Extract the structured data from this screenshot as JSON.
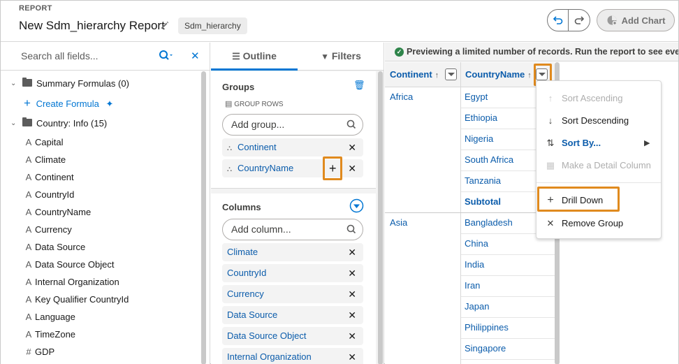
{
  "header": {
    "eyebrow": "REPORT",
    "title": "New Sdm_hierarchy Report",
    "report_type": "Sdm_hierarchy",
    "add_chart_label": "Add Chart"
  },
  "fields_panel": {
    "search_placeholder": "Search all fields...",
    "summary_formulas_label": "Summary Formulas (0)",
    "create_formula_label": "Create Formula",
    "country_info_label": "Country: Info (15)",
    "fields": [
      {
        "glyph": "A",
        "label": "Capital"
      },
      {
        "glyph": "A",
        "label": "Climate"
      },
      {
        "glyph": "A",
        "label": "Continent"
      },
      {
        "glyph": "A",
        "label": "CountryId"
      },
      {
        "glyph": "A",
        "label": "CountryName"
      },
      {
        "glyph": "A",
        "label": "Currency"
      },
      {
        "glyph": "A",
        "label": "Data Source"
      },
      {
        "glyph": "A",
        "label": "Data Source Object"
      },
      {
        "glyph": "A",
        "label": "Internal Organization"
      },
      {
        "glyph": "A",
        "label": "Key Qualifier CountryId"
      },
      {
        "glyph": "A",
        "label": "Language"
      },
      {
        "glyph": "A",
        "label": "TimeZone"
      },
      {
        "glyph": "#",
        "label": "GDP"
      }
    ]
  },
  "outline": {
    "tab_outline": "Outline",
    "tab_filters": "Filters",
    "groups_title": "Groups",
    "group_rows_label": "GROUP ROWS",
    "add_group_placeholder": "Add group...",
    "groups": [
      "Continent",
      "CountryName"
    ],
    "columns_title": "Columns",
    "add_column_placeholder": "Add column...",
    "columns": [
      "Climate",
      "CountryId",
      "Currency",
      "Data Source",
      "Data Source Object",
      "Internal Organization"
    ]
  },
  "preview": {
    "banner": "Previewing a limited number of records. Run the report to see everything.",
    "col_continent": "Continent",
    "col_countryname": "CountryName",
    "sort_arrow": "↑",
    "rows": [
      {
        "continent": "Africa",
        "country": "Egypt"
      },
      {
        "continent": "",
        "country": "Ethiopia"
      },
      {
        "continent": "",
        "country": "Nigeria"
      },
      {
        "continent": "",
        "country": "South Africa"
      },
      {
        "continent": "",
        "country": "Tanzania"
      },
      {
        "continent": "",
        "country": "Subtotal"
      },
      {
        "continent": "Asia",
        "country": "Bangladesh"
      },
      {
        "continent": "",
        "country": "China"
      },
      {
        "continent": "",
        "country": "India"
      },
      {
        "continent": "",
        "country": "Iran"
      },
      {
        "continent": "",
        "country": "Japan"
      },
      {
        "continent": "",
        "country": "Philippines"
      },
      {
        "continent": "",
        "country": "Singapore"
      }
    ]
  },
  "column_menu": {
    "sort_ascending": "Sort Ascending",
    "sort_descending": "Sort Descending",
    "sort_by": "Sort By...",
    "make_detail_column": "Make a Detail Column",
    "drill_down": "Drill Down",
    "remove_group": "Remove Group"
  },
  "colors": {
    "brand_blue": "#0176d3",
    "link_blue": "#0b5cab",
    "highlight_orange": "#e08a1e",
    "success_green": "#2e844a"
  }
}
